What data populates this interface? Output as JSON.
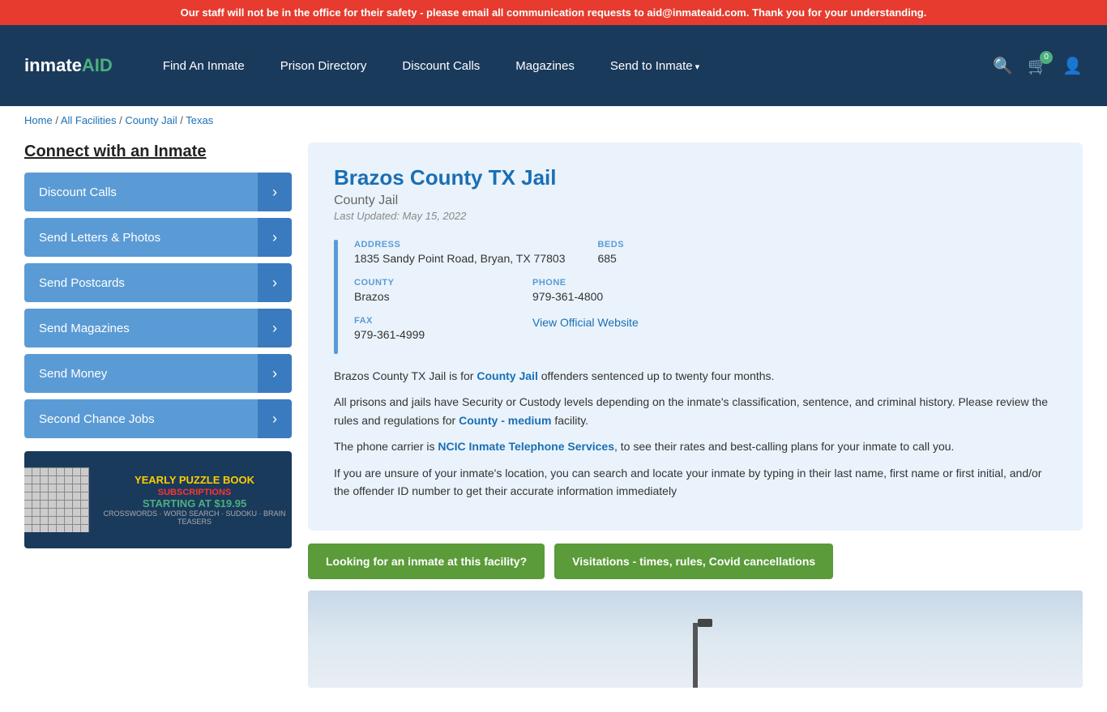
{
  "alert": {
    "text": "Our staff will not be in the office for their safety - please email all communication requests to aid@inmateaid.com. Thank you for your understanding."
  },
  "header": {
    "logo": "inmateAID",
    "nav_items": [
      {
        "label": "Find An Inmate",
        "dropdown": false
      },
      {
        "label": "Prison Directory",
        "dropdown": false
      },
      {
        "label": "Discount Calls",
        "dropdown": false
      },
      {
        "label": "Magazines",
        "dropdown": false
      },
      {
        "label": "Send to Inmate",
        "dropdown": true
      }
    ],
    "cart_count": "0"
  },
  "breadcrumb": {
    "items": [
      "Home",
      "All Facilities",
      "County Jail",
      "Texas"
    ]
  },
  "sidebar": {
    "title": "Connect with an Inmate",
    "buttons": [
      {
        "label": "Discount Calls"
      },
      {
        "label": "Send Letters & Photos"
      },
      {
        "label": "Send Postcards"
      },
      {
        "label": "Send Magazines"
      },
      {
        "label": "Send Money"
      },
      {
        "label": "Second Chance Jobs"
      }
    ],
    "ad": {
      "title": "YEARLY PUZZLE BOOK",
      "sub": "SUBSCRIPTIONS",
      "price": "STARTING AT $19.95",
      "types": "CROSSWORDS · WORD SEARCH · SUDOKU · BRAIN TEASERS"
    }
  },
  "facility": {
    "name": "Brazos County TX Jail",
    "type": "County Jail",
    "last_updated": "Last Updated: May 15, 2022",
    "address_label": "ADDRESS",
    "address_value": "1835 Sandy Point Road, Bryan, TX 77803",
    "beds_label": "BEDS",
    "beds_value": "685",
    "county_label": "COUNTY",
    "county_value": "Brazos",
    "phone_label": "PHONE",
    "phone_value": "979-361-4800",
    "fax_label": "FAX",
    "fax_value": "979-361-4999",
    "website_label": "View Official Website",
    "desc1": "Brazos County TX Jail is for County Jail offenders sentenced up to twenty four months.",
    "desc2": "All prisons and jails have Security or Custody levels depending on the inmate's classification, sentence, and criminal history. Please review the rules and regulations for County - medium facility.",
    "desc3": "The phone carrier is NCIC Inmate Telephone Services, to see their rates and best-calling plans for your inmate to call you.",
    "desc4": "If you are unsure of your inmate's location, you can search and locate your inmate by typing in their last name, first name or first initial, and/or the offender ID number to get their accurate information immediately",
    "btn1": "Looking for an inmate at this facility?",
    "btn2": "Visitations - times, rules, Covid cancellations"
  }
}
